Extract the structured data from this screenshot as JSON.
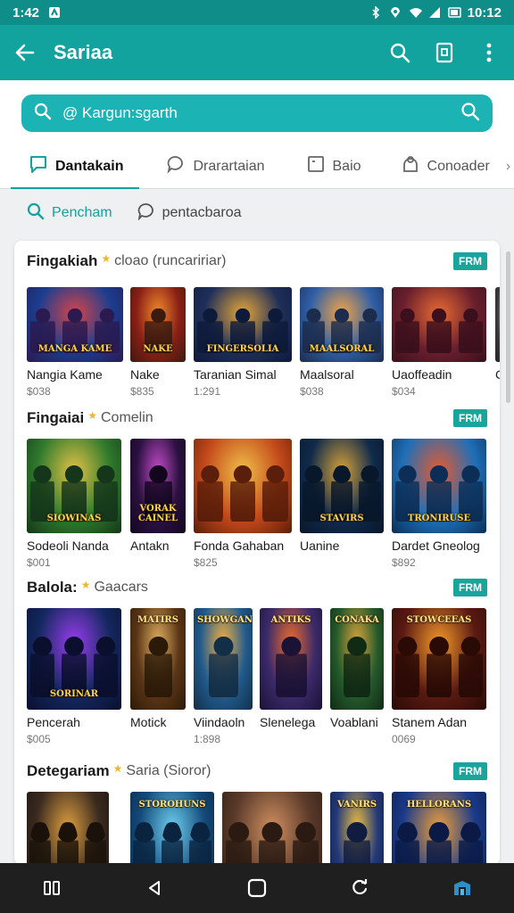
{
  "status": {
    "time": "1:42",
    "right_time": "10:12"
  },
  "appbar": {
    "title": "Sariaa"
  },
  "search": {
    "placeholder": "@ Kargun:sgarth"
  },
  "tabs": [
    {
      "label": "Dantakain",
      "icon": "chat-bubble-icon",
      "active": true
    },
    {
      "label": "Drarartaian",
      "icon": "comment-icon",
      "active": false
    },
    {
      "label": "Baio",
      "icon": "square-icon",
      "active": false
    },
    {
      "label": "Conoader",
      "icon": "bag-icon",
      "active": false
    }
  ],
  "subnav": [
    {
      "label": "Pencham",
      "icon": "search-icon",
      "active": true
    },
    {
      "label": "pentacbaroa",
      "icon": "comment-icon",
      "active": false
    }
  ],
  "sections": [
    {
      "title": "Fingakiah",
      "subtitle": "cloao (runcaririar)",
      "badge": "FRM",
      "games": [
        {
          "name": "Nangia Kame",
          "price": "$038",
          "label": "MANGA KAME"
        },
        {
          "name": "Nake",
          "price": "$835",
          "label": "NAKE"
        },
        {
          "name": "Taranian Simal",
          "price": "1:291",
          "label": "FINGERSOLIA"
        },
        {
          "name": "Maalsoral",
          "price": "$038",
          "label": "MAALSORAL"
        },
        {
          "name": "Uaoffeadin",
          "price": "$034",
          "label": ""
        },
        {
          "name": "C",
          "price": "",
          "label": ""
        }
      ]
    },
    {
      "title": "Fingaiai",
      "subtitle": "Comelin",
      "badge": "FRM",
      "games": [
        {
          "name": "Sodeoli Nanda",
          "price": "$001",
          "label": "SIOWINAS"
        },
        {
          "name": "Antakn",
          "price": "",
          "label": "VORAK CAINEL"
        },
        {
          "name": "Fonda Gahaban",
          "price": "$825",
          "label": ""
        },
        {
          "name": "Uanine",
          "price": "",
          "label": "STAVIRS"
        },
        {
          "name": "Dardet Gneolog",
          "price": "$892",
          "label": "TRONIRUSE"
        }
      ]
    },
    {
      "title": "Balola:",
      "subtitle": "Gaacars",
      "badge": "FRM",
      "games": [
        {
          "name": "Pencerah",
          "price": "$005",
          "label": "SORINAR"
        },
        {
          "name": "Motick",
          "price": "",
          "label": "MATIRS"
        },
        {
          "name": "Viindaoln",
          "price": "1:898",
          "label": "SHOWGANS"
        },
        {
          "name": "Slenelega",
          "price": "",
          "label": "ANTIKS"
        },
        {
          "name": "Voablani",
          "price": "",
          "label": "CONAKA"
        },
        {
          "name": "Stanem Adan",
          "price": "0069",
          "label": "STOWCEEAS"
        }
      ]
    },
    {
      "title": "Detegariam",
      "subtitle": "Saria (Sioror)",
      "badge": "FRM",
      "games": [
        {
          "name": "",
          "price": "",
          "label": ""
        },
        {
          "name": "",
          "price": "",
          "label": "STOROHUNS"
        },
        {
          "name": "",
          "price": "",
          "label": ""
        },
        {
          "name": "",
          "price": "",
          "label": "VANIRS"
        },
        {
          "name": "",
          "price": "",
          "label": "HELLORANS"
        }
      ]
    }
  ],
  "colors": {
    "accent": "#12a39e",
    "statusbar": "#0f8d88",
    "search": "#1cb3b4",
    "badge": "#1aa59c"
  }
}
